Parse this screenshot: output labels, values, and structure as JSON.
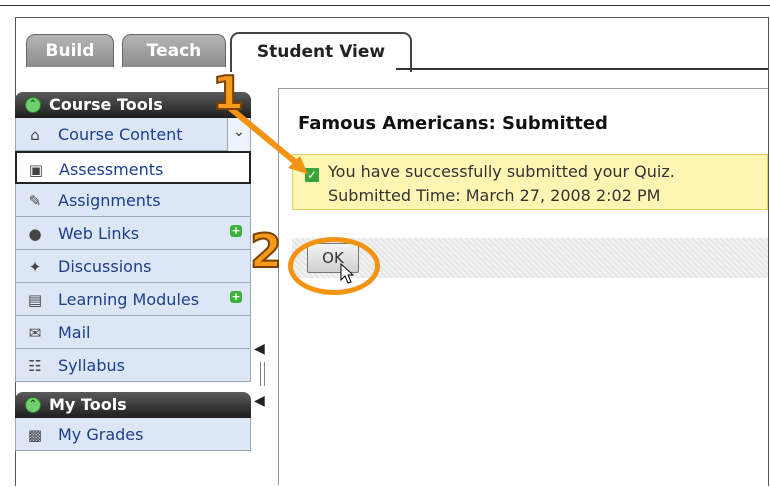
{
  "tabs": {
    "build": "Build",
    "teach": "Teach",
    "student_view": "Student View"
  },
  "sidebar": {
    "course_tools_title": "Course Tools",
    "items": [
      {
        "label": "Course Content",
        "icon": "home-icon",
        "plus": false
      },
      {
        "label": "Assessments",
        "icon": "assessment-icon",
        "plus": false
      },
      {
        "label": "Assignments",
        "icon": "assignment-icon",
        "plus": false
      },
      {
        "label": "Web Links",
        "icon": "globe-icon",
        "plus": true
      },
      {
        "label": "Discussions",
        "icon": "pin-icon",
        "plus": false
      },
      {
        "label": "Learning Modules",
        "icon": "module-icon",
        "plus": true
      },
      {
        "label": "Mail",
        "icon": "mail-icon",
        "plus": false
      },
      {
        "label": "Syllabus",
        "icon": "syllabus-icon",
        "plus": false
      }
    ],
    "my_tools_title": "My Tools",
    "my_tools_items": [
      {
        "label": "My Grades",
        "icon": "grades-icon"
      }
    ]
  },
  "main": {
    "title": "Famous Americans: Submitted",
    "success_line1": "You have successfully submitted your Quiz.",
    "success_line2": "Submitted Time: March 27, 2008 2:02 PM",
    "ok_label": "OK"
  },
  "annotations": {
    "step1": "1",
    "step2": "2"
  },
  "colors": {
    "accent_orange": "#f29312",
    "sidebar_bg": "#dde6f4",
    "link_blue": "#1a3f8c",
    "success_bg": "#fff6b4"
  }
}
